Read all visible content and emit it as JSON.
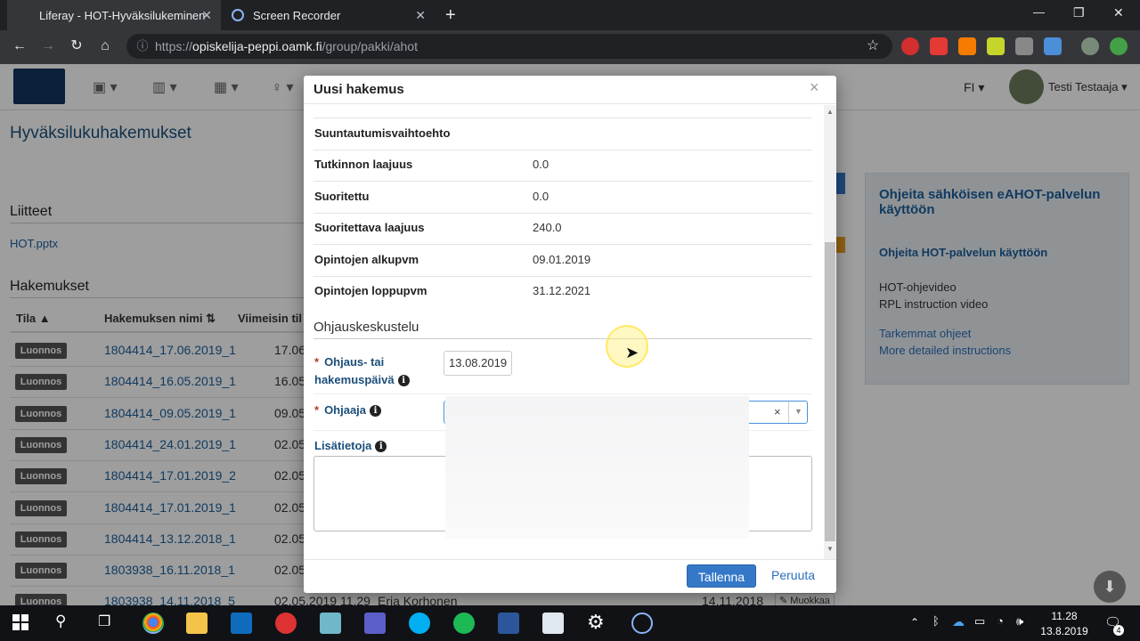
{
  "browser": {
    "tabs": [
      {
        "title": "Liferay - HOT-Hyväksilukeminen",
        "active": true
      },
      {
        "title": "Screen Recorder",
        "active": false
      }
    ],
    "url_prefix": "https://",
    "url_host": "opiskelija-peppi.oamk.fi",
    "url_path": "/group/pakki/ahot",
    "new_tab": "+",
    "win_min": "—",
    "win_restore": "❐",
    "win_close": "✕"
  },
  "nav": {
    "language": "FI",
    "user_name": "Testi Testaaja"
  },
  "page": {
    "title": "Hyväksilukuhakemukset",
    "attachments_heading": "Liitteet",
    "attachment_file": "HOT.pptx",
    "applications_heading": "Hakemukset",
    "columns": {
      "status": "Tila",
      "name": "Hakemuksen nimi",
      "modified": "Viimeisin til"
    },
    "rows": [
      {
        "status": "Luonnos",
        "name": "1804414_17.06.2019_1",
        "date": "17.06"
      },
      {
        "status": "Luonnos",
        "name": "1804414_16.05.2019_1",
        "date": "16.05"
      },
      {
        "status": "Luonnos",
        "name": "1804414_09.05.2019_1",
        "date": "09.05."
      },
      {
        "status": "Luonnos",
        "name": "1804414_24.01.2019_1",
        "date": "02.05"
      },
      {
        "status": "Luonnos",
        "name": "1804414_17.01.2019_2",
        "date": "02.05"
      },
      {
        "status": "Luonnos",
        "name": "1804414_17.01.2019_1",
        "date": "02.05"
      },
      {
        "status": "Luonnos",
        "name": "1804414_13.12.2018_1",
        "date": "02.05"
      },
      {
        "status": "Luonnos",
        "name": "1803938_16.11.2018_1",
        "date": "02.05"
      },
      {
        "status": "Luonnos",
        "name": "1803938_14.11.2018_5",
        "date": "02.05.2019 11.29"
      }
    ],
    "last_row_person": "Erja Korhonen",
    "last_row_date2": "14.11.2018",
    "last_row_edit": "Muokkaa"
  },
  "help_panel": {
    "title": "Ohjeita sähköisen eAHOT-palvelun käyttöön",
    "subtitle": "Ohjeita HOT-palvelun käyttöön",
    "video_fi": "HOT-ohjevideo",
    "video_en": "RPL instruction video",
    "more_fi": "Tarkemmat ohjeet",
    "more_en": "More detailed instructions"
  },
  "modal": {
    "title": "Uusi hakemus",
    "close": "×",
    "fields": [
      {
        "label": "Suuntautumisvaihtoehto",
        "value": ""
      },
      {
        "label": "Tutkinnon laajuus",
        "value": "0.0"
      },
      {
        "label": "Suoritettu",
        "value": "0.0"
      },
      {
        "label": "Suoritettava laajuus",
        "value": "240.0"
      },
      {
        "label": "Opintojen alkupvm",
        "value": "09.01.2019"
      },
      {
        "label": "Opintojen loppupvm",
        "value": "31.12.2021"
      }
    ],
    "section": "Ohjauskeskustelu",
    "guidance_date_label": "Ohjaus- tai hakemuspäivä",
    "guidance_date_value": "13.08.2019",
    "supervisor_label": "Ohjaaja",
    "extra_label": "Lisätietoja",
    "save": "Tallenna",
    "cancel": "Peruuta"
  },
  "taskbar": {
    "time": "11.28",
    "date": "13.8.2019",
    "notifications": "4"
  }
}
